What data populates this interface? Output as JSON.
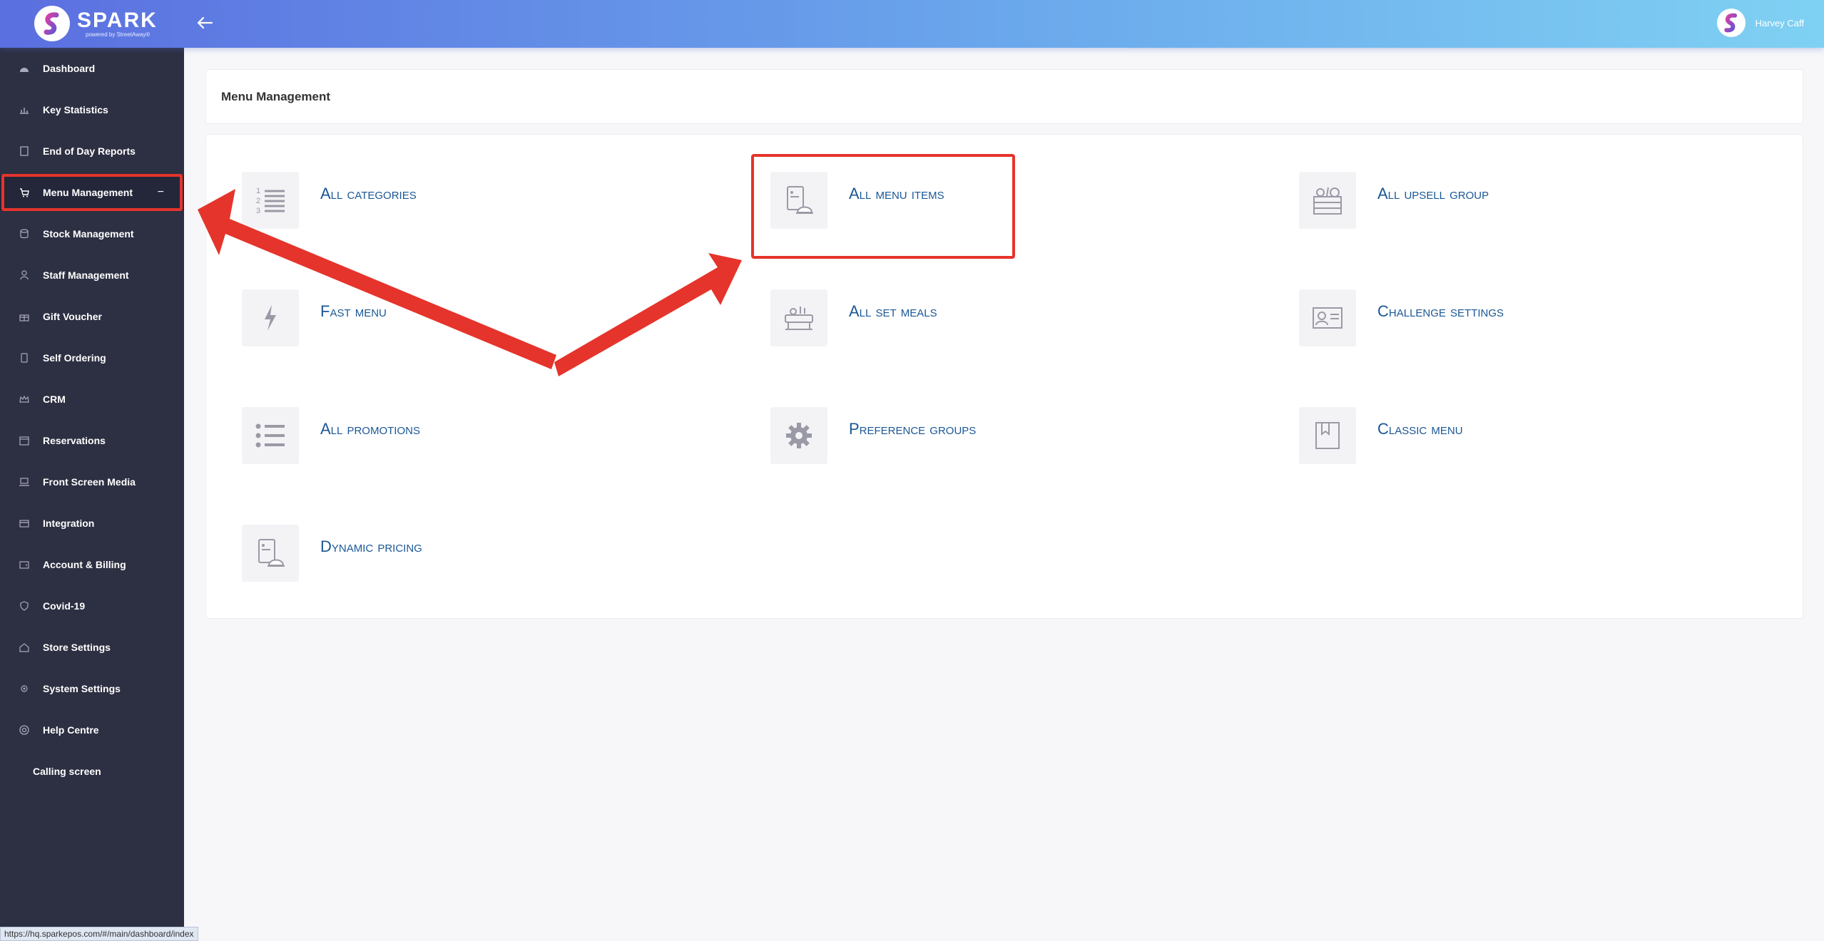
{
  "app": {
    "name": "SPARK",
    "tagline": "powered by StreetAway®"
  },
  "header": {
    "user_name": "Harvey Caff"
  },
  "sidebar": {
    "items": [
      {
        "label": "Dashboard",
        "icon": "dashboard-icon"
      },
      {
        "label": "Key Statistics",
        "icon": "bar-chart-icon"
      },
      {
        "label": "End of Day Reports",
        "icon": "report-icon"
      },
      {
        "label": "Menu Management",
        "icon": "cart-icon",
        "active": true,
        "collapse": "−"
      },
      {
        "label": "Stock Management",
        "icon": "database-icon"
      },
      {
        "label": "Staff Management",
        "icon": "user-icon"
      },
      {
        "label": "Gift Voucher",
        "icon": "gift-icon"
      },
      {
        "label": "Self Ordering",
        "icon": "tablet-icon"
      },
      {
        "label": "CRM",
        "icon": "crown-icon"
      },
      {
        "label": "Reservations",
        "icon": "calendar-icon"
      },
      {
        "label": "Front Screen Media",
        "icon": "laptop-icon"
      },
      {
        "label": "Integration",
        "icon": "credit-card-icon"
      },
      {
        "label": "Account & Billing",
        "icon": "wallet-icon"
      },
      {
        "label": "Covid-19",
        "icon": "shield-icon"
      },
      {
        "label": "Store Settings",
        "icon": "store-icon"
      },
      {
        "label": "System Settings",
        "icon": "gear-icon"
      },
      {
        "label": "Help Centre",
        "icon": "lifebuoy-icon"
      },
      {
        "label": "Calling screen",
        "icon": ""
      }
    ]
  },
  "main": {
    "title": "Menu Management",
    "tiles": [
      {
        "label": "All categories",
        "icon": "numbered-list-icon"
      },
      {
        "label": "All menu items",
        "icon": "menu-book-icon"
      },
      {
        "label": "All upsell group",
        "icon": "food-box-icon"
      },
      {
        "label": "Fast menu",
        "icon": "lightning-icon"
      },
      {
        "label": "All set meals",
        "icon": "set-meal-icon"
      },
      {
        "label": "Challenge settings",
        "icon": "id-card-icon"
      },
      {
        "label": "All promotions",
        "icon": "bullet-list-icon"
      },
      {
        "label": "Preference groups",
        "icon": "gear-icon"
      },
      {
        "label": "Classic menu",
        "icon": "bookmark-book-icon"
      },
      {
        "label": "Dynamic pricing",
        "icon": "menu-book-icon"
      }
    ]
  },
  "status_bar": {
    "url": "https://hq.sparkepos.com/#/main/dashboard/index"
  },
  "colors": {
    "annotation": "#e5342b",
    "sidebar": "#2d2f42",
    "link": "#1a5796"
  }
}
